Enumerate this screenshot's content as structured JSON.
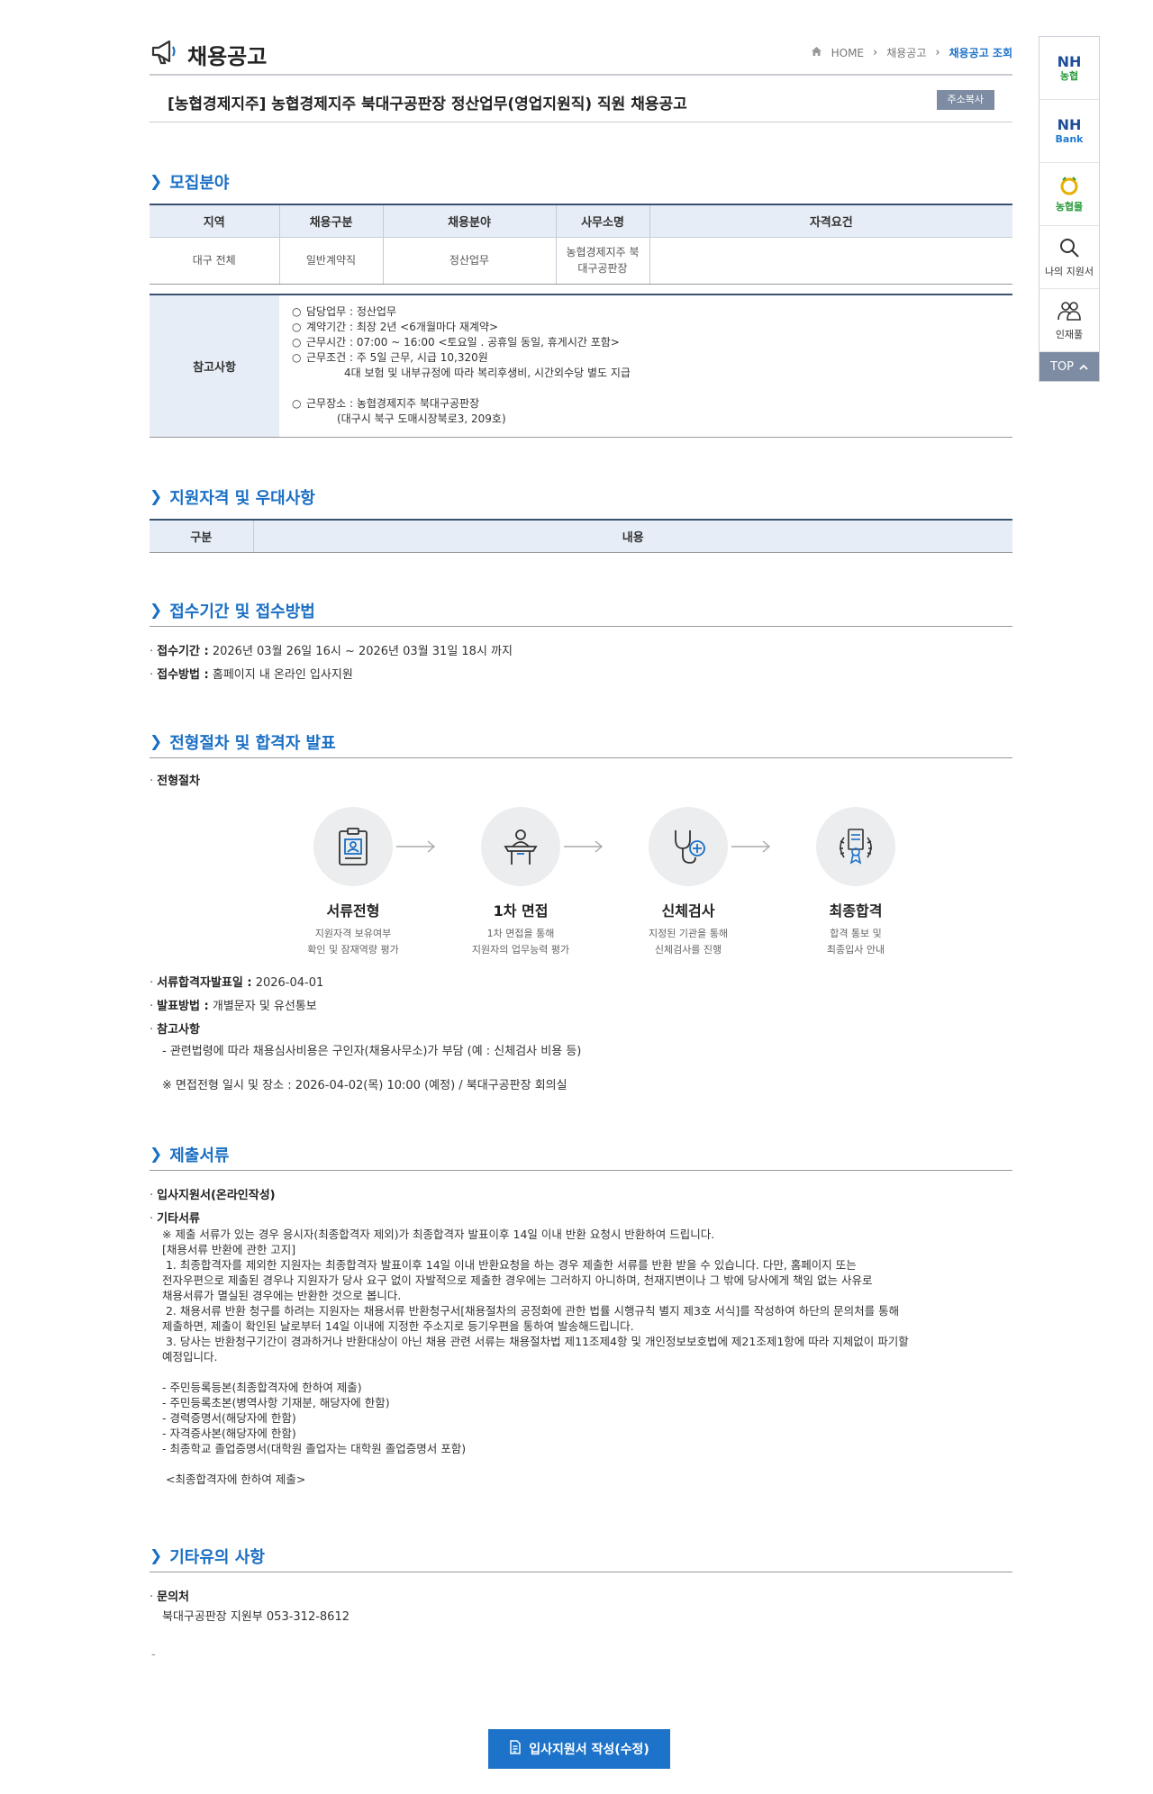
{
  "header": {
    "title": "채용공고",
    "breadcrumb": [
      "HOME",
      "채용공고",
      "채용공고 조회"
    ]
  },
  "job": {
    "title": "[농협경제지주] 농협경제지주 북대구공판장 정산업무(영업지원직) 직원 채용공고",
    "copy_button": "주소복사"
  },
  "sections": {
    "recruit": "모집분야",
    "qualification": "지원자격 및 우대사항",
    "reception": "접수기간 및 접수방법",
    "selection": "전형절차 및 합격자 발표",
    "documents": "제출서류",
    "etc": "기타유의 사항"
  },
  "recruit_table": {
    "headers": [
      "지역",
      "채용구분",
      "채용분야",
      "사무소명",
      "자격요건"
    ],
    "row": [
      "대구 전체",
      "일반계약직",
      "정산업무",
      "농협경제지주 북\n대구공판장",
      ""
    ]
  },
  "notes": {
    "label": "참고사항",
    "lines": [
      "담당업무 : 정산업무",
      "계약기간 : 최장 2년 <6개월마다 재계약>",
      "근무시간 : 07:00 ~ 16:00 <토요일 . 공휴일 동일, 휴게시간 포함>",
      "근무조건 : 주 5일 근무, 시급 10,320원",
      "4대 보험 및 내부규정에 따라 복리후생비, 시간외수당 별도 지급",
      "근무장소 : 농협경제지주 북대구공판장",
      "(대구시 북구 도매시장북로3, 209호)"
    ]
  },
  "qual_table": {
    "headers": [
      "구분",
      "내용"
    ]
  },
  "reception": {
    "period_label": "접수기간 :",
    "period": "2026년 03월 26일 16시 ~ 2026년 03월 31일 18시 까지",
    "method_label": "접수방법 :",
    "method": "홈페이지 내 온라인 입사지원"
  },
  "selection": {
    "process_label": "전형절차",
    "steps": [
      {
        "name": "서류전형",
        "desc1": "지원자격 보유여부",
        "desc2": "확인 및 잠재역량 평가",
        "icon": "clipboard-icon"
      },
      {
        "name": "1차 면접",
        "desc1": "1차 면접을 통해",
        "desc2": "지원자의 업무능력 평가",
        "icon": "interview-icon"
      },
      {
        "name": "신체검사",
        "desc1": "지정된 기관을 통해",
        "desc2": "신체검사를 진행",
        "icon": "stethoscope-icon"
      },
      {
        "name": "최종합격",
        "desc1": "합격 통보 및",
        "desc2": "최종입사 안내",
        "icon": "certificate-icon"
      }
    ],
    "announce_label": "서류합격자발표일 :",
    "announce": "2026-04-01",
    "method_label": "발표방법 :",
    "method": "개별문자 및 유선통보",
    "note_label": "참고사항",
    "note1": "- 관련법령에 따라 채용심사비용은 구인자(채용사무소)가 부담 (예 : 신체검사 비용 등)",
    "note2": "※ 면접전형 일시 및 장소 : 2026-04-02(목) 10:00 (예정) / 북대구공판장 회의실"
  },
  "documents": {
    "item1": "입사지원서(온라인작성)",
    "item2": "기타서류",
    "text": "※ 제출 서류가 있는 경우 응시자(최종합격자 제외)가 최종합격자 발표이후 14일 이내 반환 요청시 반환하여 드립니다.\n[채용서류 반환에 관한 고지]\n 1. 최종합격자를 제외한 지원자는 최종합격자 발표이후 14일 이내 반환요청을 하는 경우 제출한 서류를 반환 받을 수 있습니다. 다만, 홈페이지 또는\n전자우편으로 제출된 경우나 지원자가 당사 요구 없이 자발적으로 제출한 경우에는 그러하지 아니하며, 천재지변이나 그 밖에 당사에게 책임 없는 사유로\n채용서류가 멸실된 경우에는 반환한 것으로 봅니다.\n 2. 채용서류 반환 청구를 하려는 지원자는 채용서류 반환청구서[채용절차의 공정화에 관한 법률 시행규칙 별지 제3호 서식]를 작성하여 하단의 문의처를 통해\n제출하면, 제출이 확인된 날로부터 14일 이내에 지정한 주소지로 등기우편을 통하여 발송해드립니다.\n 3. 당사는 반환청구기간이 경과하거나 반환대상이 아닌 채용 관련 서류는 채용절차법 제11조제4항 및 개인정보보호법에 제21조제1항에 따라 지체없이 파기할\n예정입니다.\n\n- 주민등록등본(최종합격자에 한하여 제출)\n- 주민등록초본(병역사항 기재분, 해당자에 한함)\n- 경력증명서(해당자에 한함)\n- 자격증사본(해당자에 한함)\n- 최종학교 졸업증명서(대학원 졸업자는 대학원 졸업증명서 포함)\n\n <최종합격자에 한하여 제출>"
  },
  "etc": {
    "contact_label": "문의처",
    "contact": "북대구공판장 지원부 053-312-8612",
    "trailing": "-"
  },
  "quick_menu": {
    "nh1_top": "NH",
    "nh1_sub": "농협",
    "nh2_top": "NH",
    "nh2_sub": "Bank",
    "mall": "농협몰",
    "my_app": "나의 지원서",
    "talent": "인재풀",
    "top": "TOP"
  },
  "apply_button": "입사지원서 작성(수정)",
  "colors": {
    "accent": "#1d73c9",
    "table_head": "#e6edf6",
    "dark_line": "#3b5170"
  }
}
